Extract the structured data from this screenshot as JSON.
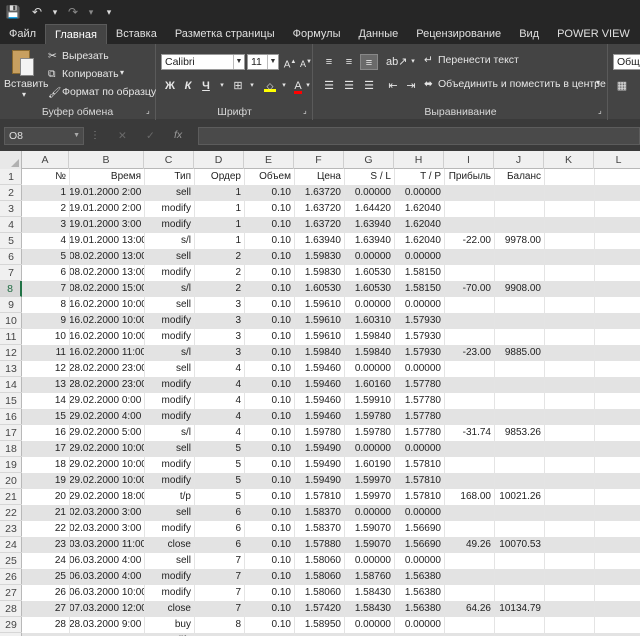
{
  "quick_access": {
    "save_icon": "💾",
    "undo_icon": "↶",
    "undo_dd": "▾",
    "redo_icon": "↷",
    "redo_dd": "▾",
    "customize_icon": "▾"
  },
  "tabs": [
    "Файл",
    "Главная",
    "Вставка",
    "Разметка страницы",
    "Формулы",
    "Данные",
    "Рецензирование",
    "Вид",
    "POWER VIEW",
    "КОНС"
  ],
  "active_tab": 1,
  "ribbon": {
    "clipboard": {
      "paste": "Вставить",
      "cut": "Вырезать",
      "copy": "Копировать",
      "format_painter": "Формат по образцу",
      "label": "Буфер обмена"
    },
    "font": {
      "font_name": "Calibri",
      "font_size": "11",
      "bold": "Ж",
      "italic": "К",
      "underline": "Ч",
      "label": "Шрифт"
    },
    "alignment": {
      "wrap": "Перенести текст",
      "merge": "Объединить и поместить в центре",
      "label": "Выравнивание"
    },
    "number": {
      "format": "Общи"
    }
  },
  "formula_bar": {
    "name_box": "O8",
    "cancel": "✕",
    "enter": "✓",
    "fx": "fx",
    "value": ""
  },
  "columns": [
    "A",
    "B",
    "C",
    "D",
    "E",
    "F",
    "G",
    "H",
    "I",
    "J",
    "K",
    "L"
  ],
  "selected_row": 8,
  "sheet": {
    "headers": [
      "№",
      "Время",
      "Тип",
      "Ордер",
      "Объем",
      "Цена",
      "S / L",
      "T / P",
      "Прибыль",
      "Баланс"
    ],
    "rows": [
      [
        "1",
        "19.01.2000 2:00",
        "sell",
        "1",
        "0.10",
        "1.63720",
        "0.00000",
        "0.00000",
        "",
        ""
      ],
      [
        "2",
        "19.01.2000 2:00",
        "modify",
        "1",
        "0.10",
        "1.63720",
        "1.64420",
        "1.62040",
        "",
        ""
      ],
      [
        "3",
        "19.01.2000 3:00",
        "modify",
        "1",
        "0.10",
        "1.63720",
        "1.63940",
        "1.62040",
        "",
        ""
      ],
      [
        "4",
        "19.01.2000 13:00",
        "s/l",
        "1",
        "0.10",
        "1.63940",
        "1.63940",
        "1.62040",
        "-22.00",
        "9978.00"
      ],
      [
        "5",
        "08.02.2000 13:00",
        "sell",
        "2",
        "0.10",
        "1.59830",
        "0.00000",
        "0.00000",
        "",
        ""
      ],
      [
        "6",
        "08.02.2000 13:00",
        "modify",
        "2",
        "0.10",
        "1.59830",
        "1.60530",
        "1.58150",
        "",
        ""
      ],
      [
        "7",
        "08.02.2000 15:00",
        "s/l",
        "2",
        "0.10",
        "1.60530",
        "1.60530",
        "1.58150",
        "-70.00",
        "9908.00"
      ],
      [
        "8",
        "16.02.2000 10:00",
        "sell",
        "3",
        "0.10",
        "1.59610",
        "0.00000",
        "0.00000",
        "",
        ""
      ],
      [
        "9",
        "16.02.2000 10:00",
        "modify",
        "3",
        "0.10",
        "1.59610",
        "1.60310",
        "1.57930",
        "",
        ""
      ],
      [
        "10",
        "16.02.2000 10:00",
        "modify",
        "3",
        "0.10",
        "1.59610",
        "1.59840",
        "1.57930",
        "",
        ""
      ],
      [
        "11",
        "16.02.2000 11:00",
        "s/l",
        "3",
        "0.10",
        "1.59840",
        "1.59840",
        "1.57930",
        "-23.00",
        "9885.00"
      ],
      [
        "12",
        "28.02.2000 23:00",
        "sell",
        "4",
        "0.10",
        "1.59460",
        "0.00000",
        "0.00000",
        "",
        ""
      ],
      [
        "13",
        "28.02.2000 23:00",
        "modify",
        "4",
        "0.10",
        "1.59460",
        "1.60160",
        "1.57780",
        "",
        ""
      ],
      [
        "14",
        "29.02.2000 0:00",
        "modify",
        "4",
        "0.10",
        "1.59460",
        "1.59910",
        "1.57780",
        "",
        ""
      ],
      [
        "15",
        "29.02.2000 4:00",
        "modify",
        "4",
        "0.10",
        "1.59460",
        "1.59780",
        "1.57780",
        "",
        ""
      ],
      [
        "16",
        "29.02.2000 5:00",
        "s/l",
        "4",
        "0.10",
        "1.59780",
        "1.59780",
        "1.57780",
        "-31.74",
        "9853.26"
      ],
      [
        "17",
        "29.02.2000 10:00",
        "sell",
        "5",
        "0.10",
        "1.59490",
        "0.00000",
        "0.00000",
        "",
        ""
      ],
      [
        "18",
        "29.02.2000 10:00",
        "modify",
        "5",
        "0.10",
        "1.59490",
        "1.60190",
        "1.57810",
        "",
        ""
      ],
      [
        "19",
        "29.02.2000 10:00",
        "modify",
        "5",
        "0.10",
        "1.59490",
        "1.59970",
        "1.57810",
        "",
        ""
      ],
      [
        "20",
        "29.02.2000 18:00",
        "t/p",
        "5",
        "0.10",
        "1.57810",
        "1.59970",
        "1.57810",
        "168.00",
        "10021.26"
      ],
      [
        "21",
        "02.03.2000 3:00",
        "sell",
        "6",
        "0.10",
        "1.58370",
        "0.00000",
        "0.00000",
        "",
        ""
      ],
      [
        "22",
        "02.03.2000 3:00",
        "modify",
        "6",
        "0.10",
        "1.58370",
        "1.59070",
        "1.56690",
        "",
        ""
      ],
      [
        "23",
        "03.03.2000 11:00",
        "close",
        "6",
        "0.10",
        "1.57880",
        "1.59070",
        "1.56690",
        "49.26",
        "10070.53"
      ],
      [
        "24",
        "06.03.2000 4:00",
        "sell",
        "7",
        "0.10",
        "1.58060",
        "0.00000",
        "0.00000",
        "",
        ""
      ],
      [
        "25",
        "06.03.2000 4:00",
        "modify",
        "7",
        "0.10",
        "1.58060",
        "1.58760",
        "1.56380",
        "",
        ""
      ],
      [
        "26",
        "06.03.2000 10:00",
        "modify",
        "7",
        "0.10",
        "1.58060",
        "1.58430",
        "1.56380",
        "",
        ""
      ],
      [
        "27",
        "07.03.2000 12:00",
        "close",
        "7",
        "0.10",
        "1.57420",
        "1.58430",
        "1.56380",
        "64.26",
        "10134.79"
      ],
      [
        "28",
        "28.03.2000 9:00",
        "buy",
        "8",
        "0.10",
        "1.58950",
        "0.00000",
        "0.00000",
        "",
        ""
      ],
      [
        "29",
        "28.03.2000 9:00",
        "modify",
        "8",
        "0.10",
        "1.58950",
        "1.58250",
        "1.60630",
        "",
        ""
      ]
    ]
  }
}
